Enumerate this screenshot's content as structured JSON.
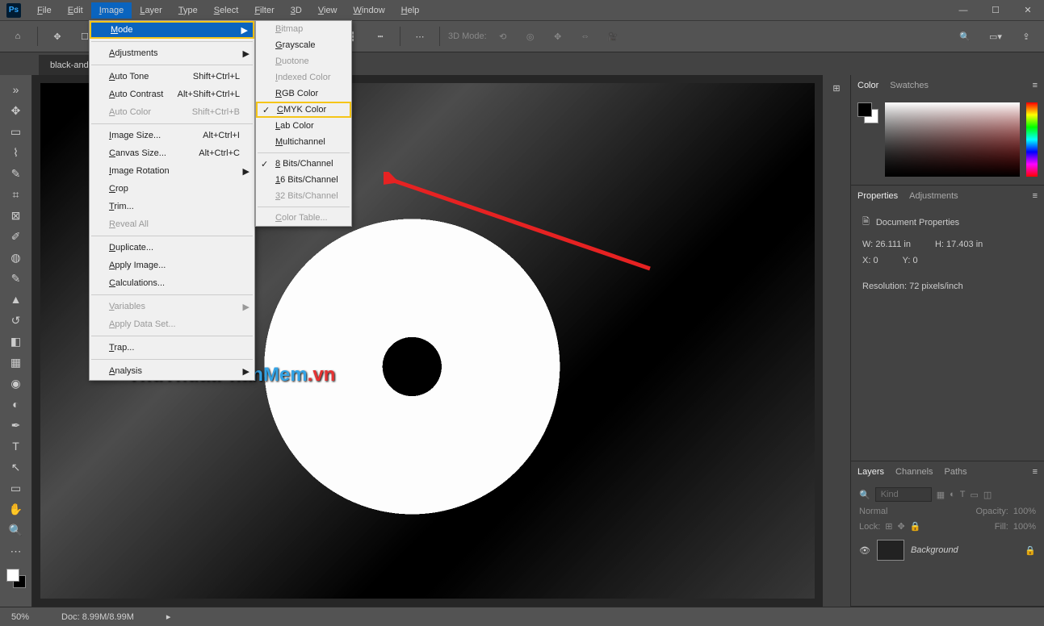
{
  "menubar": {
    "items": [
      "File",
      "Edit",
      "Image",
      "Layer",
      "Type",
      "Select",
      "Filter",
      "3D",
      "View",
      "Window",
      "Help"
    ],
    "active": 2
  },
  "doc_tab": "black-and-",
  "image_menu": [
    {
      "label": "Mode",
      "hl": true,
      "sub": true
    },
    {
      "sep": true
    },
    {
      "label": "Adjustments",
      "sub": true
    },
    {
      "sep": true
    },
    {
      "label": "Auto Tone",
      "sc": "Shift+Ctrl+L"
    },
    {
      "label": "Auto Contrast",
      "sc": "Alt+Shift+Ctrl+L"
    },
    {
      "label": "Auto Color",
      "sc": "Shift+Ctrl+B",
      "disabled": true
    },
    {
      "sep": true
    },
    {
      "label": "Image Size...",
      "sc": "Alt+Ctrl+I"
    },
    {
      "label": "Canvas Size...",
      "sc": "Alt+Ctrl+C"
    },
    {
      "label": "Image Rotation",
      "sub": true
    },
    {
      "label": "Crop"
    },
    {
      "label": "Trim..."
    },
    {
      "label": "Reveal All",
      "disabled": true
    },
    {
      "sep": true
    },
    {
      "label": "Duplicate..."
    },
    {
      "label": "Apply Image..."
    },
    {
      "label": "Calculations..."
    },
    {
      "sep": true
    },
    {
      "label": "Variables",
      "sub": true,
      "disabled": true
    },
    {
      "label": "Apply Data Set...",
      "disabled": true
    },
    {
      "sep": true
    },
    {
      "label": "Trap..."
    },
    {
      "sep": true
    },
    {
      "label": "Analysis",
      "sub": true
    }
  ],
  "mode_submenu": [
    {
      "label": "Bitmap",
      "disabled": true
    },
    {
      "label": "Grayscale"
    },
    {
      "label": "Duotone",
      "disabled": true
    },
    {
      "label": "Indexed Color",
      "disabled": true
    },
    {
      "label": "RGB Color"
    },
    {
      "label": "CMYK Color",
      "chk": true,
      "boxed": true
    },
    {
      "label": "Lab Color"
    },
    {
      "label": "Multichannel"
    },
    {
      "sep": true
    },
    {
      "label": "8 Bits/Channel",
      "chk": true
    },
    {
      "label": "16 Bits/Channel"
    },
    {
      "label": "32 Bits/Channel",
      "disabled": true
    },
    {
      "sep": true
    },
    {
      "label": "Color Table...",
      "disabled": true
    }
  ],
  "options": {
    "mode_label": "3D Mode:"
  },
  "watermark": {
    "p1": "ThuThuat",
    "p2": "PhanMem",
    "p3": ".vn"
  },
  "panels": {
    "color": {
      "tabs": [
        "Color",
        "Swatches"
      ]
    },
    "properties": {
      "tabs": [
        "Properties",
        "Adjustments"
      ],
      "title": "Document Properties",
      "w_label": "W:",
      "w": "26.111 in",
      "h_label": "H:",
      "h": "17.403 in",
      "x_label": "X:",
      "x": "0",
      "y_label": "Y:",
      "y": "0",
      "res": "Resolution: 72 pixels/inch"
    },
    "layers": {
      "tabs": [
        "Layers",
        "Channels",
        "Paths"
      ],
      "search_placeholder": "Kind",
      "blend": "Normal",
      "opacity_label": "Opacity:",
      "opacity": "100%",
      "lock_label": "Lock:",
      "fill_label": "Fill:",
      "fill": "100%",
      "layer0": "Background"
    }
  },
  "status": {
    "zoom": "50%",
    "doc": "Doc: 8.99M/8.99M"
  }
}
